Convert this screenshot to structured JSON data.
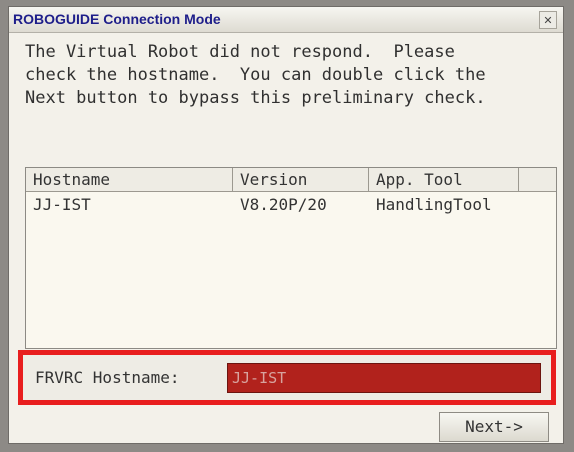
{
  "window": {
    "title": "ROBOGUIDE Connection Mode",
    "close_glyph": "✕"
  },
  "message": {
    "lines": [
      "The Virtual Robot did not respond.  Please",
      "check the hostname.  You can double click the",
      "Next button to bypass this preliminary check."
    ]
  },
  "table": {
    "columns": [
      "Hostname",
      "Version",
      "App. Tool"
    ],
    "rows": [
      {
        "hostname": "JJ-IST",
        "version": "V8.20P/20",
        "app_tool": "HandlingTool"
      }
    ]
  },
  "hostname_field": {
    "label": "FRVRC Hostname:",
    "value": "JJ-IST"
  },
  "buttons": {
    "next": "Next->"
  },
  "colors": {
    "highlight_border": "#e81e1e",
    "input_background": "#b1221c"
  }
}
